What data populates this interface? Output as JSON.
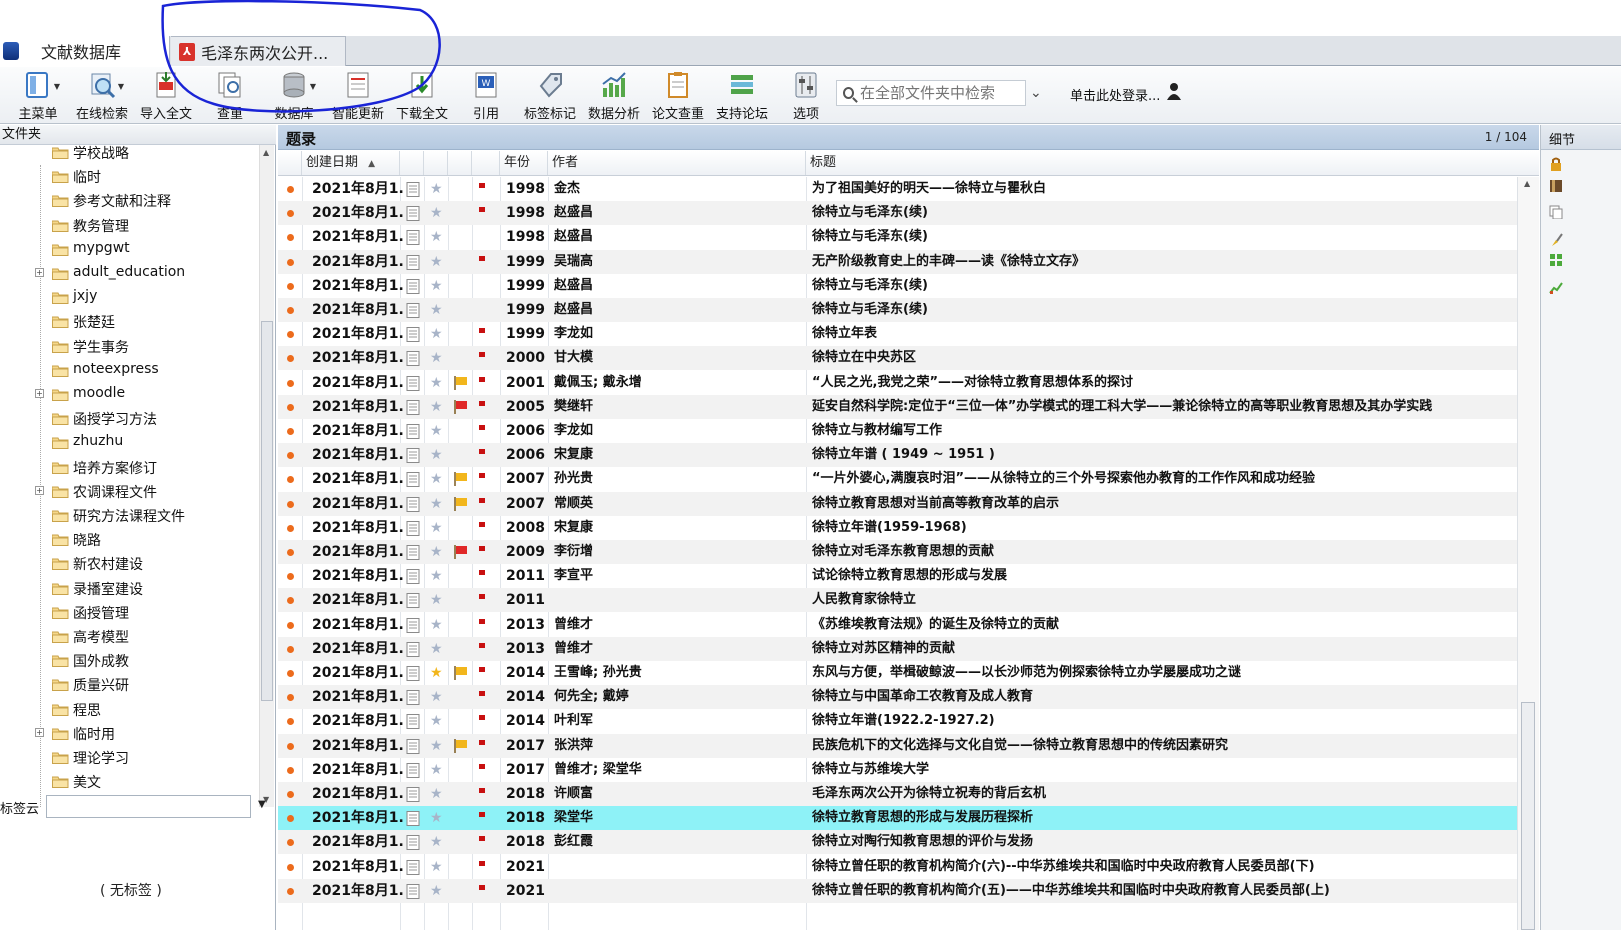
{
  "tabs": [
    {
      "label": "文献数据库",
      "icon": "database-icon"
    },
    {
      "label": "毛泽东两次公开...",
      "icon": "pdf-icon"
    }
  ],
  "toolbar": {
    "buttons": [
      {
        "label": "主菜单",
        "icon": "main-menu-icon"
      },
      {
        "label": "在线检索",
        "icon": "online-search-icon"
      },
      {
        "label": "导入全文",
        "icon": "import-fulltext-icon"
      },
      {
        "label": "查重",
        "icon": "find-duplicates-icon"
      },
      {
        "label": "数据库",
        "icon": "database-icon"
      },
      {
        "label": "智能更新",
        "icon": "smart-update-icon"
      },
      {
        "label": "下载全文",
        "icon": "download-fulltext-icon"
      },
      {
        "label": "引用",
        "icon": "cite-icon"
      },
      {
        "label": "标签标记",
        "icon": "tag-icon"
      },
      {
        "label": "数据分析",
        "icon": "data-analysis-icon"
      },
      {
        "label": "论文查重",
        "icon": "paper-check-icon"
      },
      {
        "label": "支持论坛",
        "icon": "forum-icon"
      },
      {
        "label": "选项",
        "icon": "options-icon"
      }
    ],
    "search_placeholder": "在全部文件夹中检索",
    "login_label": "单击此处登录..."
  },
  "left_panel": {
    "header": "文件夹",
    "folders": [
      {
        "label": "学校战略",
        "expandable": false
      },
      {
        "label": "临时",
        "expandable": false
      },
      {
        "label": "参考文献和注释",
        "expandable": false
      },
      {
        "label": "教务管理",
        "expandable": false
      },
      {
        "label": "mypgwt",
        "expandable": false
      },
      {
        "label": "adult_education",
        "expandable": true
      },
      {
        "label": "jxjy",
        "expandable": false
      },
      {
        "label": "张楚廷",
        "expandable": false
      },
      {
        "label": "学生事务",
        "expandable": false
      },
      {
        "label": "noteexpress",
        "expandable": false
      },
      {
        "label": "moodle",
        "expandable": true
      },
      {
        "label": "函授学习方法",
        "expandable": false
      },
      {
        "label": "zhuzhu",
        "expandable": false
      },
      {
        "label": "培养方案修订",
        "expandable": false
      },
      {
        "label": "农调课程文件",
        "expandable": true
      },
      {
        "label": "研究方法课程文件",
        "expandable": false
      },
      {
        "label": "晓路",
        "expandable": false
      },
      {
        "label": "新农村建设",
        "expandable": false
      },
      {
        "label": "录播室建设",
        "expandable": false
      },
      {
        "label": "函授管理",
        "expandable": false
      },
      {
        "label": "高考模型",
        "expandable": false
      },
      {
        "label": "国外成教",
        "expandable": false
      },
      {
        "label": "质量兴研",
        "expandable": false
      },
      {
        "label": "程思",
        "expandable": false
      },
      {
        "label": "临时用",
        "expandable": true
      },
      {
        "label": "理论学习",
        "expandable": false
      },
      {
        "label": "美文",
        "expandable": false
      }
    ],
    "tag_cloud_label": "标签云",
    "no_tag_text": "( 无标签 )"
  },
  "main": {
    "title": "题录",
    "page_indicator": "1 / 104",
    "columns": [
      "创建日期",
      "年份",
      "作者",
      "标题"
    ],
    "rows": [
      {
        "date": "2021年8月1.",
        "year": "1998",
        "author": "金杰",
        "title": "为了祖国美好的明天——徐特立与瞿秋白",
        "star": false,
        "flag": "",
        "mark": true
      },
      {
        "date": "2021年8月1.",
        "year": "1998",
        "author": "赵盛昌",
        "title": "徐特立与毛泽东(续)",
        "star": false,
        "flag": "",
        "mark": true
      },
      {
        "date": "2021年8月1.",
        "year": "1998",
        "author": "赵盛昌",
        "title": "徐特立与毛泽东(续)",
        "star": false,
        "flag": "",
        "mark": false
      },
      {
        "date": "2021年8月1.",
        "year": "1999",
        "author": "吴瑞高",
        "title": "无产阶级教育史上的丰碑——读《徐特立文存》",
        "star": false,
        "flag": "",
        "mark": true
      },
      {
        "date": "2021年8月1.",
        "year": "1999",
        "author": "赵盛昌",
        "title": "徐特立与毛泽东(续)",
        "star": false,
        "flag": "",
        "mark": false
      },
      {
        "date": "2021年8月1.",
        "year": "1999",
        "author": "赵盛昌",
        "title": "徐特立与毛泽东(续)",
        "star": false,
        "flag": "",
        "mark": false
      },
      {
        "date": "2021年8月1.",
        "year": "1999",
        "author": "李龙如",
        "title": "徐特立年表",
        "star": false,
        "flag": "",
        "mark": true
      },
      {
        "date": "2021年8月1.",
        "year": "2000",
        "author": "甘大模",
        "title": "徐特立在中央苏区",
        "star": false,
        "flag": "",
        "mark": true
      },
      {
        "date": "2021年8月1.",
        "year": "2001",
        "author": "戴佩玉; 戴永增",
        "title": "“人民之光,我党之荣”——对徐特立教育思想体系的探讨",
        "star": false,
        "flag": "yellow",
        "mark": true
      },
      {
        "date": "2021年8月1.",
        "year": "2005",
        "author": "樊继轩",
        "title": "延安自然科学院:定位于“三位一体”办学模式的理工科大学——兼论徐特立的高等职业教育思想及其办学实践",
        "star": false,
        "flag": "red",
        "mark": true
      },
      {
        "date": "2021年8月1.",
        "year": "2006",
        "author": "李龙如",
        "title": "徐特立与教材编写工作",
        "star": false,
        "flag": "",
        "mark": true
      },
      {
        "date": "2021年8月1.",
        "year": "2006",
        "author": "宋复康",
        "title": "徐特立年谱 ( 1949 ~ 1951 )",
        "star": false,
        "flag": "",
        "mark": true
      },
      {
        "date": "2021年8月1.",
        "year": "2007",
        "author": "孙光贵",
        "title": "“一片外婆心,满腹哀时泪”——从徐特立的三个外号探索他办教育的工作作风和成功经验",
        "star": false,
        "flag": "yellow",
        "mark": true
      },
      {
        "date": "2021年8月1.",
        "year": "2007",
        "author": "常顺英",
        "title": "徐特立教育思想对当前高等教育改革的启示",
        "star": false,
        "flag": "yellow",
        "mark": true
      },
      {
        "date": "2021年8月1.",
        "year": "2008",
        "author": "宋复康",
        "title": "徐特立年谱(1959-1968)",
        "star": false,
        "flag": "",
        "mark": true
      },
      {
        "date": "2021年8月1.",
        "year": "2009",
        "author": "李衍增",
        "title": "徐特立对毛泽东教育思想的贡献",
        "star": false,
        "flag": "red",
        "mark": true
      },
      {
        "date": "2021年8月1.",
        "year": "2011",
        "author": "李宣平",
        "title": "试论徐特立教育思想的形成与发展",
        "star": false,
        "flag": "",
        "mark": true
      },
      {
        "date": "2021年8月1.",
        "year": "2011",
        "author": "",
        "title": "人民教育家徐特立",
        "star": false,
        "flag": "",
        "mark": true
      },
      {
        "date": "2021年8月1.",
        "year": "2013",
        "author": "曾维才",
        "title": "《苏维埃教育法规》的诞生及徐特立的贡献",
        "star": false,
        "flag": "",
        "mark": true
      },
      {
        "date": "2021年8月1.",
        "year": "2013",
        "author": "曾维才",
        "title": "徐特立对苏区精神的贡献",
        "star": false,
        "flag": "",
        "mark": true
      },
      {
        "date": "2021年8月1.",
        "year": "2014",
        "author": "王雪峰; 孙光贵",
        "title": "东风与方便，举楫破鲸波——以长沙师范为例探索徐特立办学屡屡成功之谜",
        "star": true,
        "flag": "yellow",
        "mark": true
      },
      {
        "date": "2021年8月1.",
        "year": "2014",
        "author": "何先全; 戴婷",
        "title": "徐特立与中国革命工农教育及成人教育",
        "star": false,
        "flag": "",
        "mark": true
      },
      {
        "date": "2021年8月1.",
        "year": "2014",
        "author": "叶利军",
        "title": "徐特立年谱(1922.2-1927.2)",
        "star": false,
        "flag": "",
        "mark": true
      },
      {
        "date": "2021年8月1.",
        "year": "2017",
        "author": "张洪萍",
        "title": "民族危机下的文化选择与文化自觉——徐特立教育思想中的传统因素研究",
        "star": false,
        "flag": "yellow",
        "mark": true
      },
      {
        "date": "2021年8月1.",
        "year": "2017",
        "author": "曾维才; 梁堂华",
        "title": "徐特立与苏维埃大学",
        "star": false,
        "flag": "",
        "mark": true
      },
      {
        "date": "2021年8月1.",
        "year": "2018",
        "author": "许顺富",
        "title": "毛泽东两次公开为徐特立祝寿的背后玄机",
        "star": false,
        "flag": "",
        "mark": true
      },
      {
        "date": "2021年8月1.",
        "year": "2018",
        "author": "梁堂华",
        "title": "徐特立教育思想的形成与发展历程探析",
        "star": false,
        "flag": "",
        "mark": true
      },
      {
        "date": "2021年8月1.",
        "year": "2018",
        "author": "彭红霞",
        "title": "徐特立对陶行知教育思想的评价与发扬",
        "star": false,
        "flag": "",
        "mark": true
      },
      {
        "date": "2021年8月1.",
        "year": "2021",
        "author": "",
        "title": "徐特立曾任职的教育机构简介(六)--中华苏维埃共和国临时中央政府教育人民委员部(下)",
        "star": false,
        "flag": "",
        "mark": true
      },
      {
        "date": "2021年8月1.",
        "year": "2021",
        "author": "",
        "title": "徐特立曾任职的教育机构简介(五)——中华苏维埃共和国临时中央政府教育人民委员部(上)",
        "star": false,
        "flag": "",
        "mark": true
      }
    ],
    "selected_row": 26
  },
  "right_panel": {
    "header": "细节"
  },
  "colors": {
    "selected_row": "#8ef2f7",
    "annotation_ink": "#1a24d6",
    "status_dot": "#ec6b1c"
  }
}
